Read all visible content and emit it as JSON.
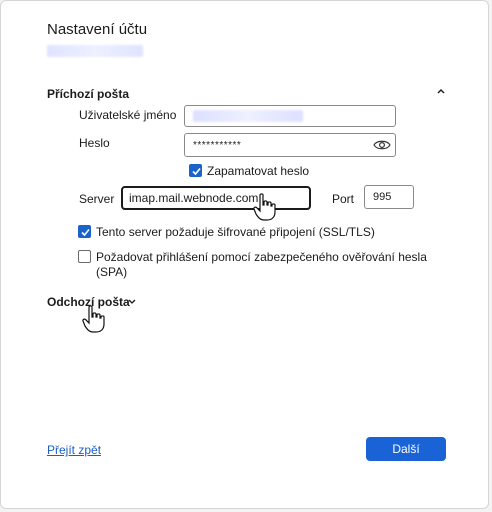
{
  "dialog": {
    "title": "Nastavení účtu"
  },
  "incoming": {
    "header": "Příchozí pošta",
    "username_label": "Uživatelské jméno",
    "password_label": "Heslo",
    "password_value": "***********",
    "remember_label": "Zapamatovat heslo",
    "remember_checked": true,
    "server_label": "Server",
    "server_value": "imap.mail.webnode.com",
    "port_label": "Port",
    "port_value": "995",
    "ssl_label": "Tento server požaduje šifrované připojení (SSL/TLS)",
    "ssl_checked": true,
    "spa_label_line1": "Požadovat přihlášení pomocí zabezpečeného ověřování hesla",
    "spa_label_line2": "(SPA)",
    "spa_checked": false
  },
  "outgoing": {
    "header": "Odchozí pošta"
  },
  "footer": {
    "back_link": "Přejít zpět",
    "next_button": "Další"
  },
  "colors": {
    "accent": "#1a63d6",
    "link": "#1a5fc1"
  },
  "icons": [
    "chevron-up-icon",
    "eye-icon",
    "checkmark-icon",
    "chevron-down-icon",
    "hand-cursor-icon"
  ]
}
